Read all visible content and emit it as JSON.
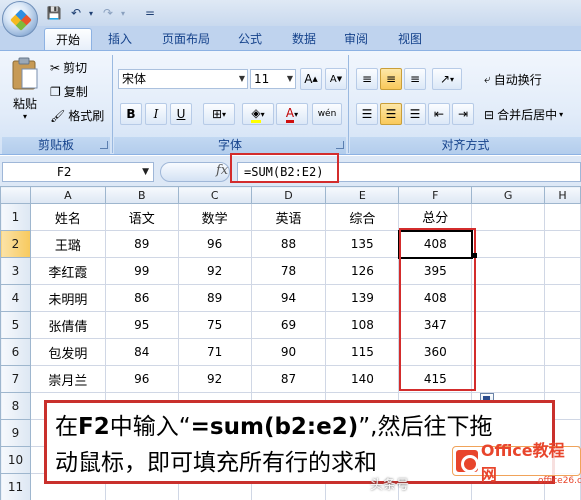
{
  "qat": {
    "save": "💾",
    "undo": "↶",
    "redo": "↷",
    "customize": "="
  },
  "tabs": [
    "开始",
    "插入",
    "页面布局",
    "公式",
    "数据",
    "审阅",
    "视图"
  ],
  "clipboard": {
    "paste": "粘贴",
    "cut": "剪切",
    "copy": "复制",
    "format_painter": "格式刷",
    "label": "剪贴板"
  },
  "font": {
    "name": "宋体",
    "size": "11",
    "grow": "A",
    "shrink": "A",
    "bold": "B",
    "italic": "I",
    "underline": "U",
    "font_color": "A",
    "phonetic": "wén",
    "label": "字体"
  },
  "alignment": {
    "wrap_text": "自动换行",
    "merge_center": "合并后居中",
    "label": "对齐方式"
  },
  "formula_bar": {
    "name_box": "F2",
    "fx": "fx",
    "formula": "=SUM(B2:E2)"
  },
  "columns": [
    "A",
    "B",
    "C",
    "D",
    "E",
    "F",
    "G",
    "H"
  ],
  "rows": [
    {
      "n": "1",
      "cells": [
        "姓名",
        "语文",
        "数学",
        "英语",
        "综合",
        "总分",
        "",
        ""
      ]
    },
    {
      "n": "2",
      "cells": [
        "王璐",
        "89",
        "96",
        "88",
        "135",
        "408",
        "",
        ""
      ]
    },
    {
      "n": "3",
      "cells": [
        "李红霞",
        "99",
        "92",
        "78",
        "126",
        "395",
        "",
        ""
      ]
    },
    {
      "n": "4",
      "cells": [
        "未明明",
        "86",
        "89",
        "94",
        "139",
        "408",
        "",
        ""
      ]
    },
    {
      "n": "5",
      "cells": [
        "张倩倩",
        "95",
        "75",
        "69",
        "108",
        "347",
        "",
        ""
      ]
    },
    {
      "n": "6",
      "cells": [
        "包发明",
        "84",
        "71",
        "90",
        "115",
        "360",
        "",
        ""
      ]
    },
    {
      "n": "7",
      "cells": [
        "崇月兰",
        "96",
        "92",
        "87",
        "140",
        "415",
        "",
        ""
      ]
    },
    {
      "n": "8",
      "cells": [
        "",
        "",
        "",
        "",
        "",
        "",
        "",
        ""
      ]
    },
    {
      "n": "9",
      "cells": [
        "",
        "",
        "",
        "",
        "",
        "",
        "",
        ""
      ]
    },
    {
      "n": "10",
      "cells": [
        "",
        "",
        "",
        "",
        "",
        "",
        "",
        ""
      ]
    },
    {
      "n": "11",
      "cells": [
        "",
        "",
        "",
        "",
        "",
        "",
        "",
        ""
      ]
    }
  ],
  "callout": {
    "line1_a": "在",
    "line1_b": "F2",
    "line1_c": "中输入“",
    "line1_d": "=sum(b2:e2)",
    "line1_e": "”,然后往下拖",
    "line2": "动鼠标，即可填充所有行的求和"
  },
  "watermark": {
    "brand": "Office教程网",
    "sub": "office26.com",
    "source": "头条号"
  }
}
